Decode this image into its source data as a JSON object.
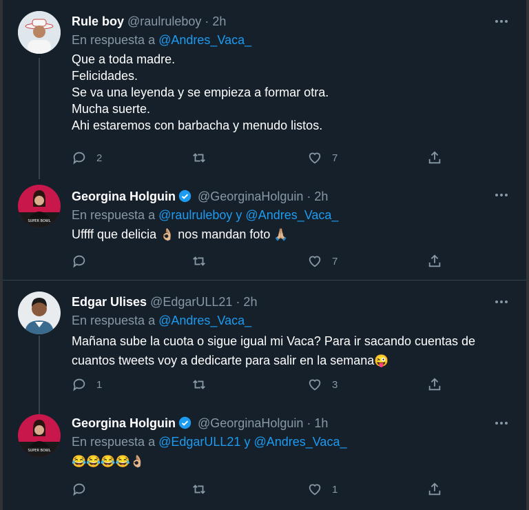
{
  "tweets": [
    {
      "name": "Rule boy",
      "handle": "@raulruleboy",
      "time": "· 2h",
      "reply_prefix": "En respuesta a",
      "reply_to": "@Andres_Vaca_",
      "lines": [
        "Que a toda madre.",
        "Felicidades.",
        "Se va una leyenda y se empieza a formar otra.",
        "Mucha suerte.",
        "Ahi estaremos con barbacha y menudo listos."
      ],
      "replies": "2",
      "retweets": "",
      "likes": "7"
    },
    {
      "name": "Georgina Holguin",
      "handle": "@GeorginaHolguin",
      "time": "· 2h",
      "reply_prefix": "En respuesta a",
      "reply_to": "@raulruleboy y @Andres_Vaca_",
      "text_a": "Uffff que delicia",
      "emoji_a": "👌🏼",
      "text_b": "nos mandan foto",
      "emoji_b": "🙏🏼",
      "replies": "",
      "retweets": "",
      "likes": "7"
    },
    {
      "name": "Edgar Ulises",
      "handle": "@EdgarULL21",
      "time": "· 2h",
      "reply_prefix": "En respuesta a",
      "reply_to": "@Andres_Vaca_",
      "line1": "Mañana sube la cuota o sigue igual mi Vaca? Para ir sacando cuentas de",
      "line2": "cuantos tweets voy a dedicarte para salir en la semana",
      "emoji": "😜",
      "replies": "1",
      "retweets": "",
      "likes": "3"
    },
    {
      "name": "Georgina Holguin",
      "handle": "@GeorginaHolguin",
      "time": "· 1h",
      "reply_prefix": "En respuesta a",
      "reply_to": "@EdgarULL21 y @Andres_Vaca_",
      "emojis": "😂😂😂😂👌🏼",
      "replies": "",
      "retweets": "",
      "likes": "1"
    }
  ],
  "colors": {
    "background": "#15202b",
    "link": "#1d9bf0",
    "muted": "#8899a6",
    "verified": "#1d9bf0"
  }
}
